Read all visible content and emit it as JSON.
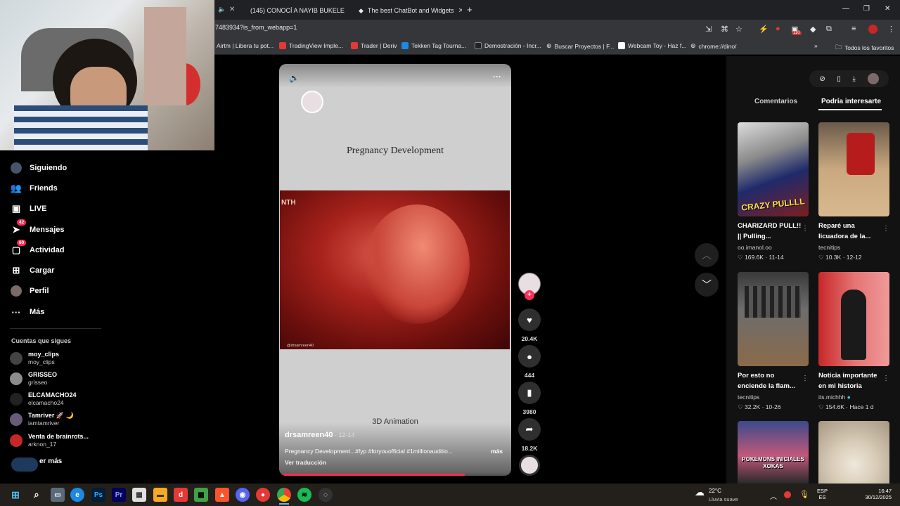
{
  "browser": {
    "tabs": [
      {
        "title": "(145) CONOCÍ A NAYIB BUKELE"
      },
      {
        "title": "The best ChatBot and Widgets"
      }
    ],
    "new_tab": "+",
    "url": "7483934?is_from_webapp=1",
    "bookmarks": [
      "Airtm | Libera tu pot...",
      "TradingView Imple...",
      "Trader | Deriv",
      "Tekken Tag Tourna...",
      "Demostración - Incr...",
      "Buscar Proyectos | F...",
      "Webcam Toy - Haz f...",
      "chrome://dino/"
    ],
    "all_bookmarks": "Todos los favoritos",
    "ext_badge": "110"
  },
  "sidebar": {
    "items": [
      {
        "label": "Siguiendo",
        "icon": "following-icon"
      },
      {
        "label": "Friends",
        "icon": "friends-icon"
      },
      {
        "label": "LIVE",
        "icon": "live-icon"
      },
      {
        "label": "Mensajes",
        "icon": "messages-icon",
        "badge": "42"
      },
      {
        "label": "Actividad",
        "icon": "activity-icon",
        "badge": "60"
      },
      {
        "label": "Cargar",
        "icon": "upload-icon"
      },
      {
        "label": "Perfil",
        "icon": "profile-icon"
      },
      {
        "label": "Más",
        "icon": "more-icon"
      }
    ],
    "following_header": "Cuentas que sigues",
    "following": [
      {
        "name": "moy_clips",
        "user": "moy_clips"
      },
      {
        "name": "GRISSEO",
        "user": "grisseo"
      },
      {
        "name": "ELCAMACHO24",
        "user": "elcamacho24"
      },
      {
        "name": "Tamriver 🚀 🌙",
        "user": "iamtamriver"
      },
      {
        "name": "Venta de brainrots...",
        "user": "arknon_17"
      }
    ],
    "see_more": "er más"
  },
  "video": {
    "title": "Pregnancy Development",
    "overlay_label": "NTH",
    "watermark": "@drsamreen40",
    "subtitle": "3D Animation",
    "author": "drsamreen40",
    "date": " · 12-14",
    "caption": "Pregnancy Development...#fyp #foryouofficial #1millionauditio...",
    "more": "más",
    "translate": "Ver traducción",
    "progress": 0.8
  },
  "actions": {
    "likes": "20.4K",
    "comments": "444",
    "saves": "3980",
    "shares": "18.2K"
  },
  "right_panel": {
    "tabs": [
      "Comentarios",
      "Podría interesarte"
    ],
    "cards": [
      {
        "title": "CHARIZARD PULL!! || Pulling...",
        "author": "oo.imanol.oo",
        "likes": "169.6K",
        "date": "11-14",
        "overlay": "CRAZY PULLLL"
      },
      {
        "title": "Reparé una licuadora de la...",
        "author": "tecnitips",
        "likes": "10.3K",
        "date": "12-12",
        "overlay": ""
      },
      {
        "title": "Por esto no enciende la flam...",
        "author": "tecnitips",
        "likes": "32.2K",
        "date": "10-26",
        "overlay": ""
      },
      {
        "title": "Noticia importante en mi historia",
        "author": "its.michhh",
        "likes": "154.6K",
        "date": "Hace 1 d",
        "overlay": ""
      },
      {
        "title": "",
        "author": "",
        "likes": "",
        "date": "",
        "overlay": "POKEMONS INICIALES XOKAS"
      },
      {
        "title": "",
        "author": "",
        "likes": "",
        "date": "",
        "overlay": ""
      }
    ]
  },
  "taskbar": {
    "weather_temp": "22°C",
    "weather_desc": "Lluvia suave",
    "lang": "ESP",
    "lang_sub": "ES",
    "time": "16:47",
    "date": "30/12/2025"
  }
}
